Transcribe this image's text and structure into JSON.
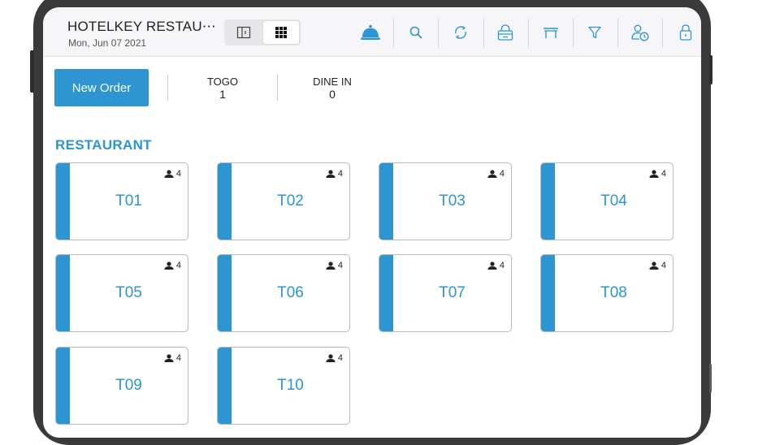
{
  "header": {
    "title": "HOTELKEY RESTAU⋯",
    "date": "Mon, Jun 07 2021",
    "view_toggle": [
      "floor-plan-view",
      "grid-view"
    ],
    "toolbar_icons": [
      "service-bell-icon",
      "search-icon",
      "refresh-icon",
      "kitchen-icon",
      "table-icon",
      "filter-icon",
      "user-clock-icon",
      "lock-icon"
    ]
  },
  "order_bar": {
    "new_order_label": "New Order",
    "togo": {
      "label": "TOGO",
      "value": "1"
    },
    "dine_in": {
      "label": "DINE IN",
      "value": "0"
    }
  },
  "section": {
    "title": "RESTAURANT"
  },
  "tables": [
    {
      "name": "T01",
      "seats": "4"
    },
    {
      "name": "T02",
      "seats": "4"
    },
    {
      "name": "T03",
      "seats": "4"
    },
    {
      "name": "T04",
      "seats": "4"
    },
    {
      "name": "T05",
      "seats": "4"
    },
    {
      "name": "T06",
      "seats": "4"
    },
    {
      "name": "T07",
      "seats": "4"
    },
    {
      "name": "T08",
      "seats": "4"
    },
    {
      "name": "T09",
      "seats": "4"
    },
    {
      "name": "T10",
      "seats": "4"
    }
  ],
  "colors": {
    "accent": "#2c95d2",
    "frame": "#3a3a3a",
    "header_bg": "#f6f6f8",
    "card_border": "#b9b9be"
  }
}
